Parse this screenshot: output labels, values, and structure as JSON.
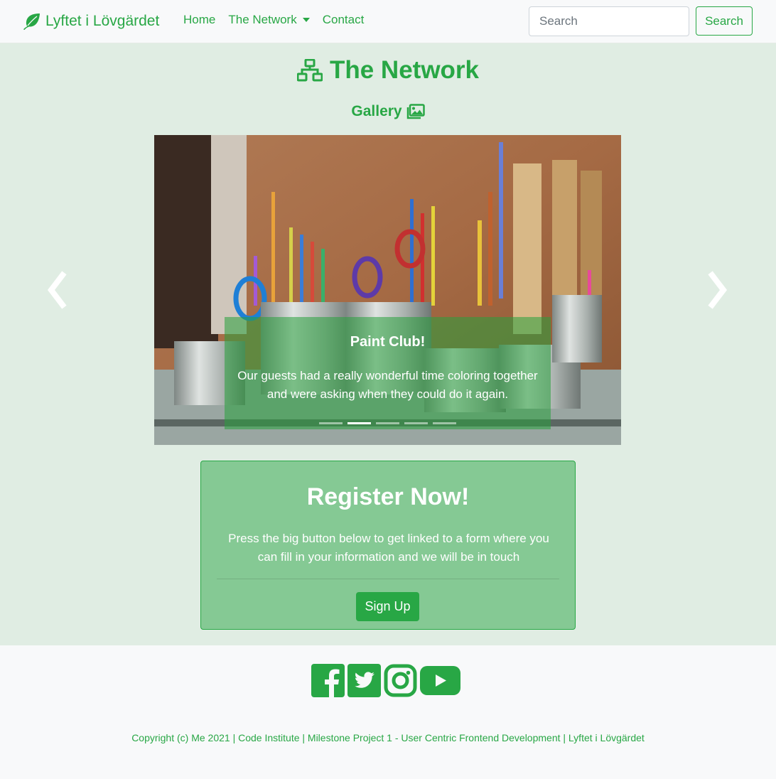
{
  "navbar": {
    "brand": "Lyftet i Lövgärdet",
    "links": [
      "Home",
      "The Network",
      "Contact"
    ],
    "search_placeholder": "Search",
    "search_button": "Search"
  },
  "main": {
    "title": "The Network",
    "gallery_title": "Gallery",
    "carousel": {
      "caption_title": "Paint Club!",
      "caption_text": "Our guests had a really wonderful time coloring together and were asking when they could do it again.",
      "slide_count": 5,
      "active_index": 1
    },
    "register": {
      "title": "Register Now!",
      "text": "Press the big button below to get linked to a form where you can fill in your information and we will be in touch",
      "button": "Sign Up"
    }
  },
  "footer": {
    "social_icons": [
      "facebook-icon",
      "twitter-icon",
      "instagram-icon",
      "youtube-icon"
    ],
    "copyright": "Copyright (c) Me 2021 | Code Institute | Milestone Project 1 - User Centric Frontend Development | Lyftet i Lövgärdet"
  },
  "colors": {
    "brand_green": "#28a745",
    "main_bg": "#e0ede3",
    "register_bg": "#85c994"
  }
}
